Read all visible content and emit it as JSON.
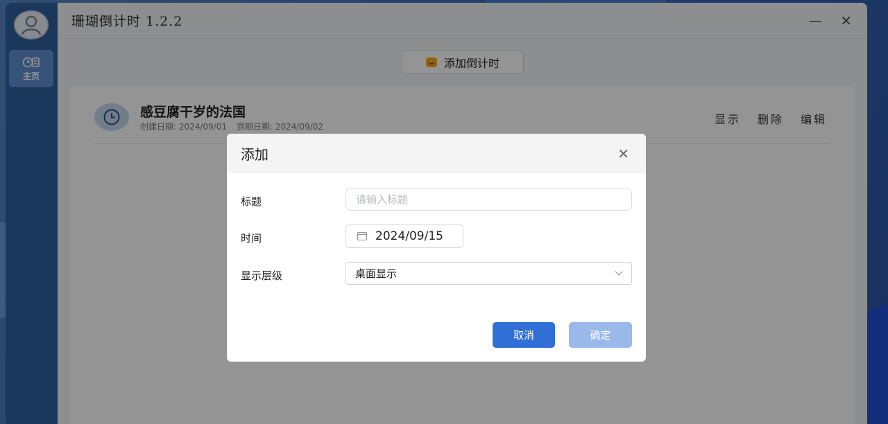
{
  "app": {
    "title": "珊瑚倒计时 1.2.2",
    "minimize": "—",
    "close": "✕"
  },
  "sidebar": {
    "home_label": "主页"
  },
  "toolbar": {
    "add_countdown_label": "添加倒计时"
  },
  "countdowns": [
    {
      "title": "感豆腐干岁的法国",
      "created": "创建日期: 2024/09/01",
      "due": "到期日期: 2024/09/02",
      "actions": [
        "显示",
        "删除",
        "编辑"
      ]
    }
  ],
  "dialog": {
    "title": "添加",
    "close": "✕",
    "title_label": "标题",
    "title_placeholder": "请输入标题",
    "title_value": "",
    "time_label": "时间",
    "time_value": "2024/09/15",
    "level_label": "显示层级",
    "level_value": "桌面显示",
    "cancel_label": "取消",
    "ok_label": "确定"
  },
  "colors": {
    "sidebar": "#2f5f9e",
    "nav_active": "#5f8fd1",
    "primary": "#2f6fd6",
    "primary_disabled": "#9ab8ea"
  }
}
